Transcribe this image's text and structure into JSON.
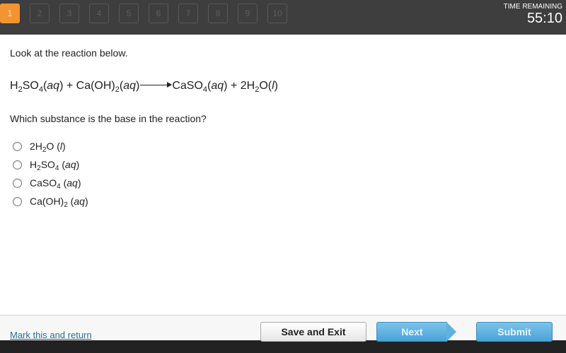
{
  "header": {
    "questions": [
      "1",
      "2",
      "3",
      "4",
      "5",
      "6",
      "7",
      "8",
      "9",
      "10"
    ],
    "active_question": "1",
    "timer_label": "TIME REMAINING",
    "timer_value": "55:10",
    "colors": {
      "bar": "#3e3e3e",
      "active": "#f39431"
    }
  },
  "prompt": {
    "intro": "Look at the reaction below.",
    "equation": {
      "reactant1": {
        "parts": [
          "H",
          "2",
          "SO",
          "4"
        ],
        "state": "aq"
      },
      "plus1": "+",
      "reactant2": {
        "parts": [
          "Ca(OH)",
          "2"
        ],
        "state": "aq"
      },
      "product1": {
        "parts": [
          "CaSO",
          "4"
        ],
        "state": "aq"
      },
      "plus2": "+",
      "product2": {
        "parts": [
          "2H",
          "2",
          "O"
        ],
        "state": "l"
      }
    },
    "question": "Which substance is the base in the reaction?"
  },
  "options": [
    {
      "parts": [
        "2H",
        "2",
        "O"
      ],
      "state": "l",
      "selected": false
    },
    {
      "parts": [
        "H",
        "2",
        "SO",
        "4"
      ],
      "state": "aq",
      "selected": false
    },
    {
      "parts": [
        "CaSO",
        "4"
      ],
      "state": "aq",
      "selected": false
    },
    {
      "parts": [
        "Ca(OH)",
        "2"
      ],
      "state": "aq",
      "selected": false
    }
  ],
  "footer": {
    "mark_link": "Mark this and return",
    "save_label": "Save and Exit",
    "next_label": "Next",
    "submit_label": "Submit"
  }
}
